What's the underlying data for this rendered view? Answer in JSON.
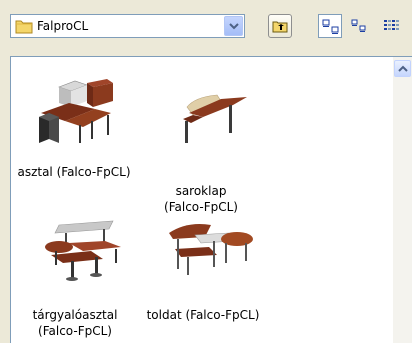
{
  "location": {
    "folder_name": "FalproCL",
    "icon": "folder-icon"
  },
  "toolbar": {
    "up_icon": "up-folder-icon",
    "views": [
      "large-icons-view-icon",
      "small-icons-view-icon",
      "list-view-icon"
    ]
  },
  "items": [
    {
      "line1": "asztal (Falco-FpCL)",
      "line2": "",
      "icon": "desk-set-thumbnail"
    },
    {
      "line1": "saroklap",
      "line2": "(Falco-FpCL)",
      "icon": "corner-top-thumbnail"
    },
    {
      "line1": "tárgyalóasztal",
      "line2": "(Falco-FpCL)",
      "icon": "meeting-table-thumbnail"
    },
    {
      "line1": "toldat (Falco-FpCL)",
      "line2": "",
      "icon": "extension-thumbnail"
    }
  ],
  "colors": {
    "window_bg": "#ece9d8",
    "list_bg": "#ffffff",
    "border": "#7f9db9",
    "wood": "#8b3a1e",
    "dark": "#404040"
  }
}
